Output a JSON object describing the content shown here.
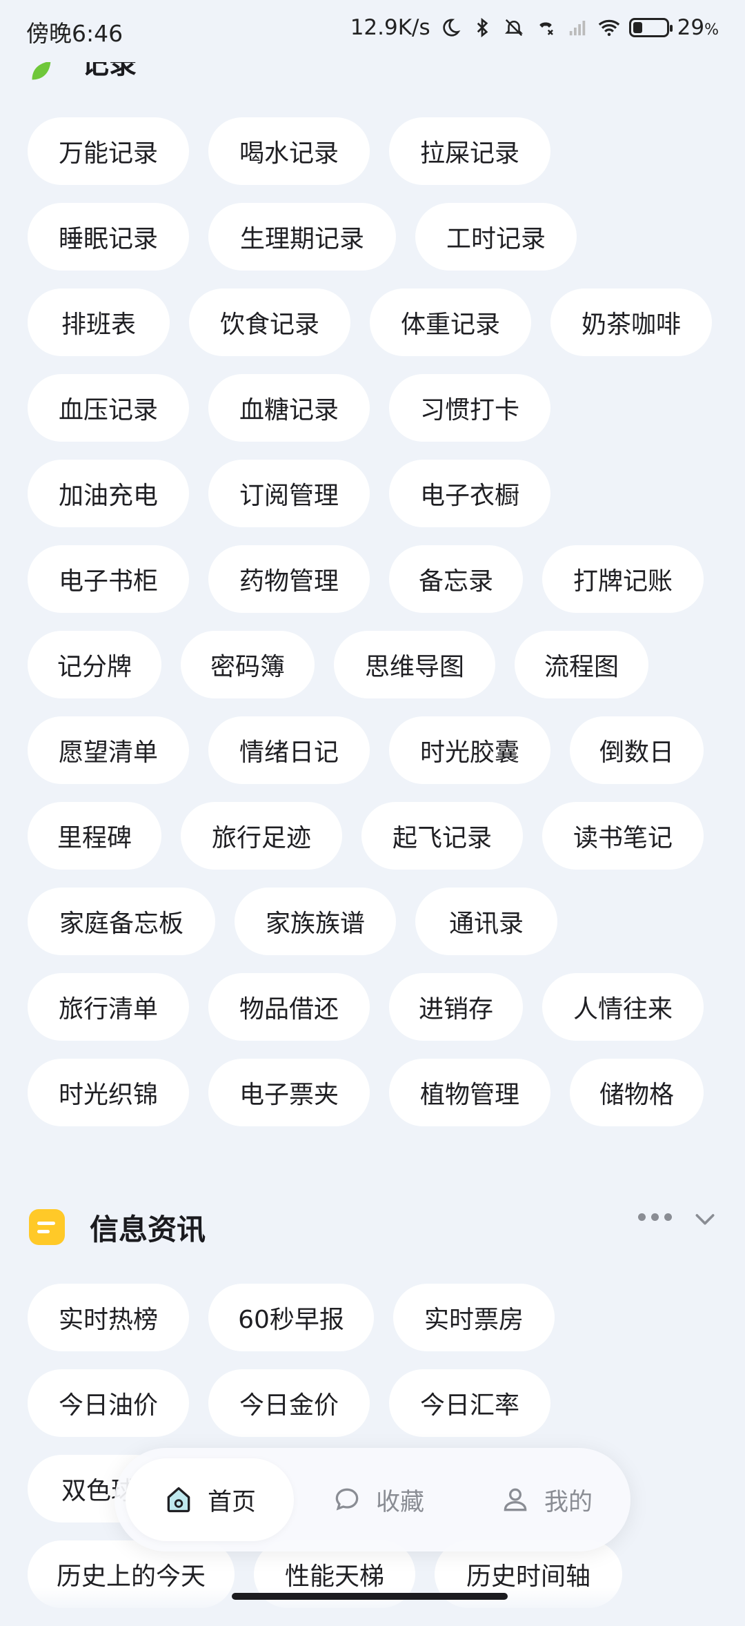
{
  "status_bar": {
    "time": "傍晚6:46",
    "network_speed": "12.9K/s",
    "battery_percent": "29",
    "battery_percent_symbol": "%",
    "battery_level": 0.29
  },
  "top_section": {
    "title": "记录"
  },
  "record_tags": [
    [
      "万能记录",
      "喝水记录",
      "拉屎记录"
    ],
    [
      "睡眠记录",
      "生理期记录",
      "工时记录"
    ],
    [
      "排班表",
      "饮食记录",
      "体重记录",
      "奶茶咖啡"
    ],
    [
      "血压记录",
      "血糖记录",
      "习惯打卡"
    ],
    [
      "加油充电",
      "订阅管理",
      "电子衣橱"
    ],
    [
      "电子书柜",
      "药物管理",
      "备忘录",
      "打牌记账"
    ],
    [
      "记分牌",
      "密码簿",
      "思维导图",
      "流程图"
    ],
    [
      "愿望清单",
      "情绪日记",
      "时光胶囊",
      "倒数日"
    ],
    [
      "里程碑",
      "旅行足迹",
      "起飞记录",
      "读书笔记"
    ],
    [
      "家庭备忘板",
      "家族族谱",
      "通讯录"
    ],
    [
      "旅行清单",
      "物品借还",
      "进销存",
      "人情往来"
    ],
    [
      "时光织锦",
      "电子票夹",
      "植物管理",
      "储物格"
    ]
  ],
  "info_section": {
    "title": "信息资讯",
    "tags": [
      [
        "实时热榜",
        "60秒早报",
        "实时票房"
      ],
      [
        "今日油价",
        "今日金价",
        "今日汇率"
      ],
      [
        "双色球",
        "",
        ""
      ],
      [
        "历史上的今天",
        "性能天梯",
        "历史时间轴"
      ]
    ]
  },
  "bottom_nav": {
    "home": "首页",
    "favorites": "收藏",
    "mine": "我的"
  }
}
